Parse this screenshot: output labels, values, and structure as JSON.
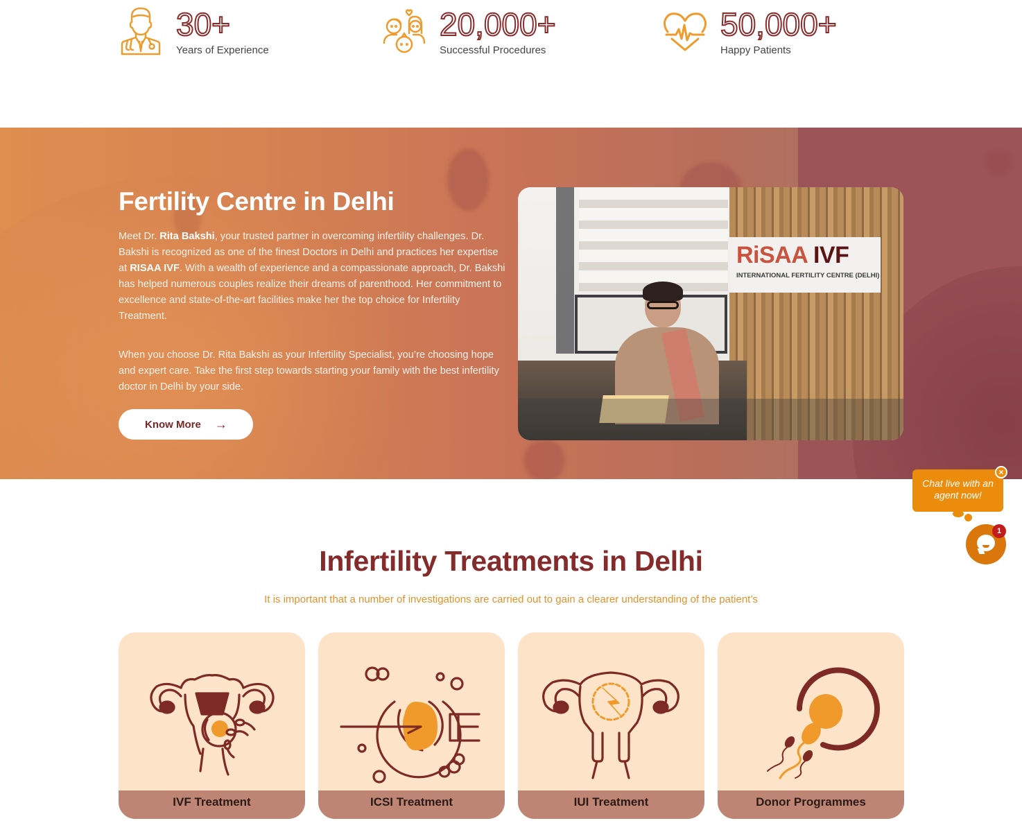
{
  "stats": [
    {
      "icon": "doctor-icon",
      "value": "30+",
      "label": "Years of Experience"
    },
    {
      "icon": "family-icon",
      "value": "20,000+",
      "label": "Successful Procedures"
    },
    {
      "icon": "heartbeat-icon",
      "value": "50,000+",
      "label": "Happy Patients"
    }
  ],
  "hero": {
    "title": "Fertility Centre in Delhi",
    "p1": {
      "t1": "Meet Dr. ",
      "b1": "Rita Bakshi",
      "t2": ", your trusted partner in overcoming infertility challenges. Dr. Bakshi is recognized as one of the finest Doctors in Delhi and practices her expertise at ",
      "b2": "RISAA IVF",
      "t3": ". With a wealth of experience and a compassionate approach, Dr. Bakshi has helped numerous couples realize their dreams of parenthood. Her commitment to excellence and state-of-the-art facilities make her the top choice for Infertility Treatment."
    },
    "p2": "When you choose Dr. Rita Bakshi as your Infertility Specialist, you’re choosing hope and expert care. Take the first step towards starting your family with the best infertility doctor in Delhi by your side.",
    "button_label": "Know More",
    "button_icon": "arrow-right-icon",
    "photo": {
      "sign_brand_part1": "RiSAA",
      "sign_brand_part2": "IVF",
      "sign_subtitle": "INTERNATIONAL FERTILITY CENTRE (DELHI)"
    }
  },
  "treatments": {
    "title": "Infertility Treatments in Delhi",
    "subtitle": "It is important that a number of investigations are carried out to gain a clearer understanding of the patient’s",
    "cards": [
      {
        "label": "IVF Treatment",
        "icon": "uterus-egg-icon"
      },
      {
        "label": "ICSI Treatment",
        "icon": "injection-egg-icon"
      },
      {
        "label": "IUI Treatment",
        "icon": "uterus-gear-icon"
      },
      {
        "label": "Donor Programmes",
        "icon": "sperm-egg-icon"
      }
    ]
  },
  "chat": {
    "bubble_text": "Chat live with an agent now!",
    "close_label": "×",
    "badge_count": "1"
  },
  "colors": {
    "accent_orange": "#ec8c0c",
    "brand_maroon": "#852b2b",
    "card_bg": "#fde3c7",
    "card_label_bg": "#bf8574"
  }
}
